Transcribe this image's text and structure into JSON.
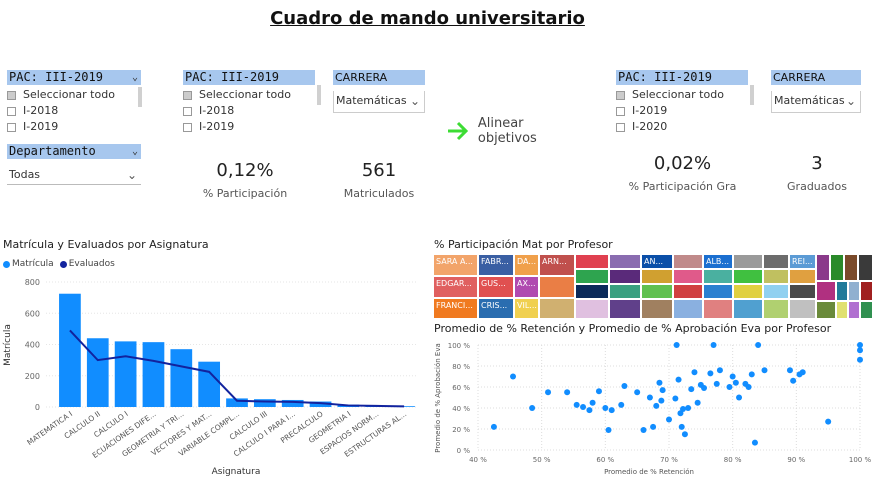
{
  "title": "Cuadro de mando universitario",
  "slicers": {
    "pac1": {
      "header": "PAC: III-2019",
      "options": [
        "Seleccionar todo",
        "I-2018",
        "I-2019"
      ]
    },
    "departamento": {
      "header": "Departamento",
      "value": "Todas"
    },
    "pac2": {
      "header": "PAC: III-2019",
      "options": [
        "Seleccionar todo",
        "I-2018",
        "I-2019"
      ]
    },
    "carrera1": {
      "header": "CARRERA",
      "value": "Matemáticas"
    },
    "pac3": {
      "header": "PAC: III-2019",
      "options": [
        "Seleccionar todo",
        "I-2019",
        "I-2020"
      ]
    },
    "carrera2": {
      "header": "CARRERA",
      "value": "Matemáticas"
    }
  },
  "align_button": {
    "label": "Alinear objetivos",
    "color": "#3ddc34"
  },
  "cards": [
    {
      "value": "0,12%",
      "label": "% Participación"
    },
    {
      "value": "561",
      "label": "Matriculados"
    },
    {
      "value": "0,02%",
      "label": "% Participación Gra"
    },
    {
      "value": "3",
      "label": "Graduados"
    }
  ],
  "bar_visual": {
    "title": "Matrícula y Evaluados por Asignatura",
    "legend": [
      "Matrícula",
      "Evaluados"
    ],
    "xlabel": "Asignatura",
    "ylabel": "Matrícula",
    "colors": {
      "bars": "#118dff",
      "line": "#12239e"
    }
  },
  "treemap_visual": {
    "title": "% Participación Mat por Profesor",
    "labels": [
      "SARA A...",
      "FABR...",
      "DA...",
      "ARN...",
      "AN...",
      "ALB...",
      "REI...",
      "EDGAR...",
      "GUS...",
      "AX...",
      "FRANCI...",
      "CRIS...",
      "VIL..."
    ]
  },
  "scatter_visual": {
    "title": "Promedio de % Retención y Promedio de % Aprobación Eva por Profesor",
    "xlabel": "Promedio de % Retención",
    "ylabel": "Promedio de % Aprobación Eva",
    "color": "#118dff"
  },
  "chart_data": [
    {
      "type": "bar",
      "title": "Matrícula y Evaluados por Asignatura",
      "xlabel": "Asignatura",
      "ylabel": "Matrícula",
      "ylim": [
        0,
        800
      ],
      "yticks": [
        "0",
        "200",
        "400",
        "600",
        "800"
      ],
      "categories": [
        "MATEMATICA I",
        "CALCULO II",
        "CALCULO I",
        "ECUACIONES DIFE...",
        "GEOMETRIA Y TRI...",
        "VECTORES Y MAT...",
        "VARIABLE COMPL...",
        "CALCULO III",
        "CALCULO I PARA I...",
        "PRECALCULO",
        "GEOMETRIA I",
        "ESPACIOS NORM...",
        "ESTRUCTURAS AL..."
      ],
      "series": [
        {
          "name": "Matrícula",
          "values": [
            725,
            440,
            420,
            415,
            370,
            290,
            55,
            50,
            45,
            35,
            15,
            10,
            5
          ]
        },
        {
          "name": "Evaluados",
          "values": [
            490,
            300,
            325,
            295,
            260,
            225,
            40,
            35,
            33,
            25,
            10,
            7,
            4
          ]
        }
      ],
      "legend": "top-left",
      "grid": true
    },
    {
      "type": "scatter",
      "title": "Promedio de % Retención y Promedio de % Aprobación Eva por Profesor",
      "xlabel": "Promedio de % Retención",
      "ylabel": "Promedio de % Aprobación Eva",
      "xlim": [
        40,
        100
      ],
      "ylim": [
        0,
        100
      ],
      "xticks": [
        "40 %",
        "50 %",
        "60 %",
        "70 %",
        "80 %",
        "90 %",
        "100 %"
      ],
      "yticks": [
        "0 %",
        "20 %",
        "40 %",
        "60 %",
        "80 %",
        "100 %"
      ],
      "points": [
        [
          42.5,
          22
        ],
        [
          45.5,
          70
        ],
        [
          48.5,
          40
        ],
        [
          51,
          55
        ],
        [
          54,
          55
        ],
        [
          55.5,
          43
        ],
        [
          56.5,
          41
        ],
        [
          57.5,
          38
        ],
        [
          58,
          45
        ],
        [
          59,
          56
        ],
        [
          60,
          40
        ],
        [
          60.5,
          19
        ],
        [
          61,
          38
        ],
        [
          62.5,
          43
        ],
        [
          63,
          61
        ],
        [
          65,
          55
        ],
        [
          66,
          19
        ],
        [
          67,
          50
        ],
        [
          67.5,
          22
        ],
        [
          68,
          42
        ],
        [
          68.5,
          64
        ],
        [
          68.8,
          47
        ],
        [
          69,
          57
        ],
        [
          70,
          29
        ],
        [
          71,
          49
        ],
        [
          71.2,
          100
        ],
        [
          71.5,
          67
        ],
        [
          71.8,
          35
        ],
        [
          72,
          22
        ],
        [
          72.2,
          39
        ],
        [
          72.5,
          15
        ],
        [
          73,
          40
        ],
        [
          73.5,
          58
        ],
        [
          74,
          74
        ],
        [
          74.5,
          45
        ],
        [
          75,
          62
        ],
        [
          75.5,
          59
        ],
        [
          76.5,
          73
        ],
        [
          77,
          100
        ],
        [
          77.5,
          63
        ],
        [
          78,
          76
        ],
        [
          79.5,
          60
        ],
        [
          80,
          70
        ],
        [
          80.5,
          64
        ],
        [
          81,
          50
        ],
        [
          82,
          63
        ],
        [
          82.5,
          60
        ],
        [
          83,
          72
        ],
        [
          83.5,
          7
        ],
        [
          84,
          100
        ],
        [
          85,
          76
        ],
        [
          89,
          76
        ],
        [
          89.5,
          66
        ],
        [
          90.5,
          72
        ],
        [
          91,
          74
        ],
        [
          95,
          27
        ],
        [
          100,
          100
        ],
        [
          100,
          86
        ],
        [
          100,
          95
        ]
      ],
      "grid": true
    }
  ]
}
